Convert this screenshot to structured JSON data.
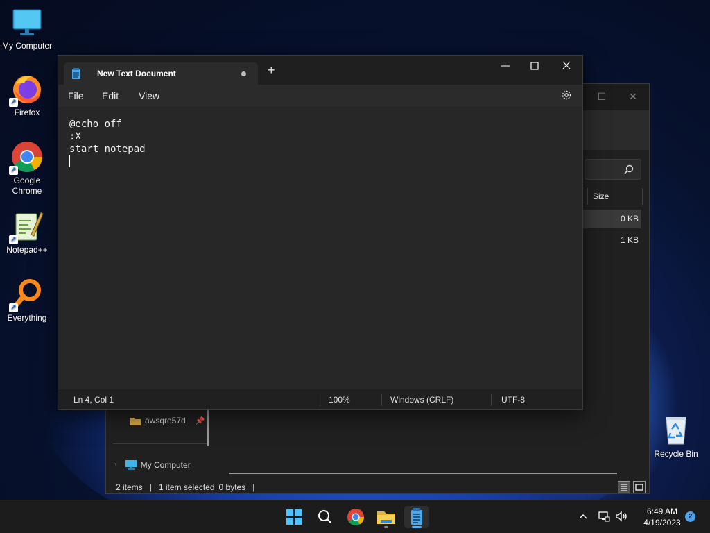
{
  "desktop": {
    "icons": [
      {
        "label": "My Computer",
        "icon": "monitor-icon"
      },
      {
        "label": "Firefox",
        "icon": "firefox-icon"
      },
      {
        "label": "Google Chrome",
        "icon": "chrome-icon"
      },
      {
        "label": "Notepad++",
        "icon": "notepadpp-icon"
      },
      {
        "label": "Everything",
        "icon": "everything-search-icon"
      },
      {
        "label": "Recycle Bin",
        "icon": "recycle-bin-icon"
      }
    ]
  },
  "explorer": {
    "column_size": "Size",
    "rows": [
      {
        "size": "0 KB",
        "selected": true
      },
      {
        "size": "1 KB",
        "selected": false
      }
    ],
    "nav": {
      "pinned_folder": "awsqre57d",
      "my_computer": "My Computer"
    },
    "status": {
      "items": "2 items",
      "selected": "1 item selected",
      "bytes": "0 bytes"
    }
  },
  "notepad": {
    "tab_title": "New Text Document",
    "unsaved": true,
    "menu": {
      "file": "File",
      "edit": "Edit",
      "view": "View"
    },
    "content_lines": [
      "@echo off",
      ":X",
      "start notepad",
      ""
    ],
    "status": {
      "position": "Ln 4, Col 1",
      "zoom": "100%",
      "line_ending": "Windows (CRLF)",
      "encoding": "UTF-8"
    }
  },
  "taskbar": {
    "apps": [
      "start-icon",
      "search-icon",
      "chrome-icon",
      "file-explorer-icon",
      "notepad-icon"
    ],
    "active_app": "notepad-icon",
    "time": "6:49 AM",
    "date": "4/19/2023",
    "notification_count": "2"
  },
  "colors": {
    "accent": "#5ab0f4",
    "window_bg": "#272727",
    "taskbar_bg": "#1c1c1c"
  }
}
